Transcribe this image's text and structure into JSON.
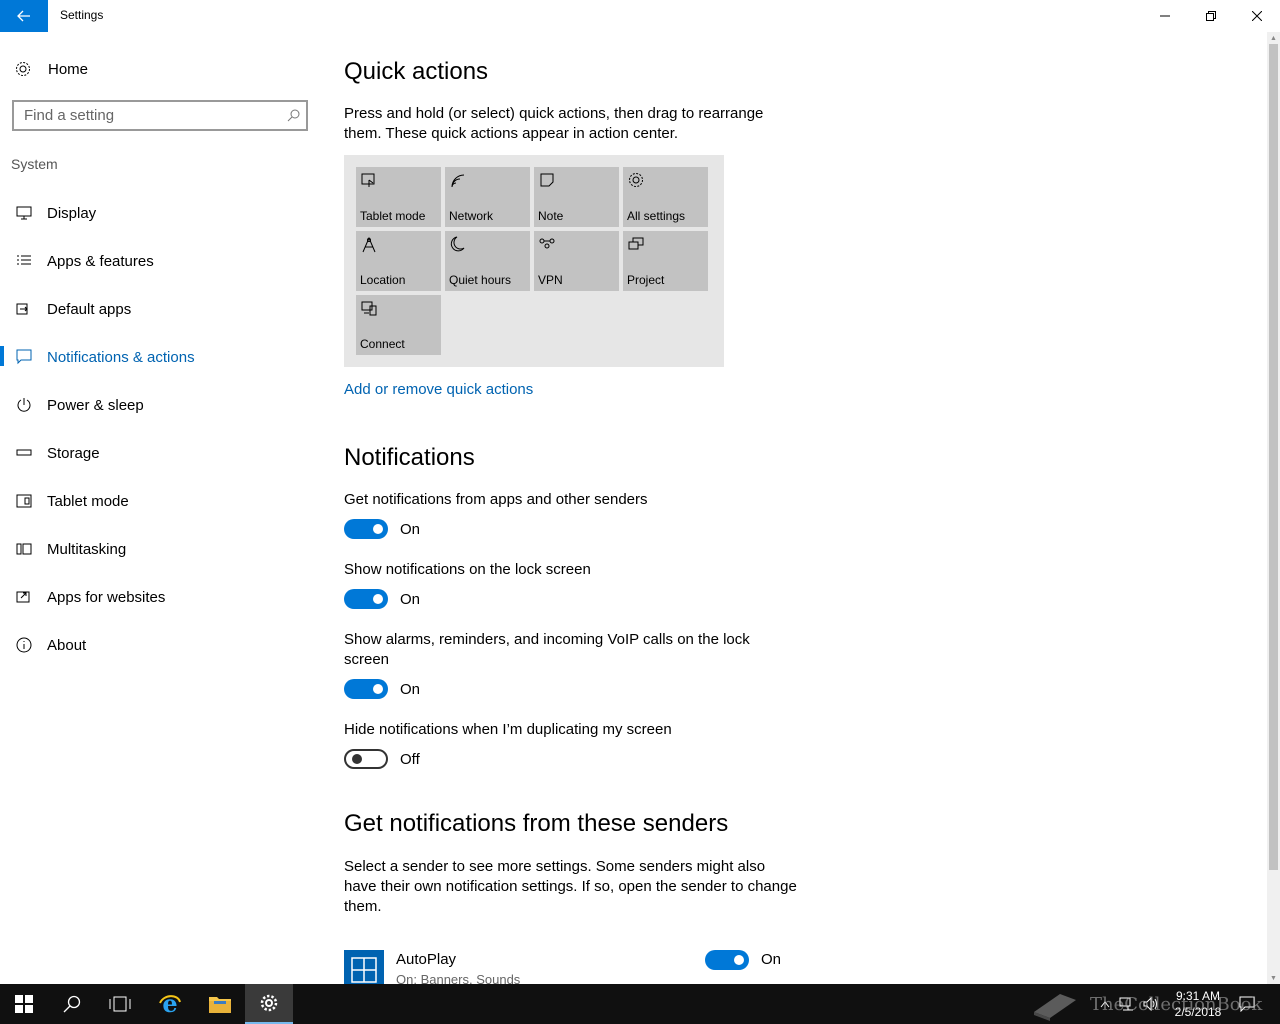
{
  "window": {
    "title": "Settings"
  },
  "sidebar": {
    "home_label": "Home",
    "search_placeholder": "Find a setting",
    "section": "System",
    "items": [
      {
        "label": "Display",
        "icon": "monitor-icon"
      },
      {
        "label": "Apps & features",
        "icon": "list-icon"
      },
      {
        "label": "Default apps",
        "icon": "default-apps-icon"
      },
      {
        "label": "Notifications & actions",
        "icon": "notification-icon",
        "active": true
      },
      {
        "label": "Power & sleep",
        "icon": "power-icon"
      },
      {
        "label": "Storage",
        "icon": "storage-icon"
      },
      {
        "label": "Tablet mode",
        "icon": "tablet-icon"
      },
      {
        "label": "Multitasking",
        "icon": "multitasking-icon"
      },
      {
        "label": "Apps for websites",
        "icon": "apps-websites-icon"
      },
      {
        "label": "About",
        "icon": "info-icon"
      }
    ]
  },
  "quick_actions": {
    "title": "Quick actions",
    "description": "Press and hold (or select) quick actions, then drag to rearrange them. These quick actions appear in action center.",
    "tiles": [
      {
        "label": "Tablet mode",
        "icon": "tablet-mode-icon"
      },
      {
        "label": "Network",
        "icon": "network-icon"
      },
      {
        "label": "Note",
        "icon": "note-icon"
      },
      {
        "label": "All settings",
        "icon": "gear-icon"
      },
      {
        "label": "Location",
        "icon": "location-icon"
      },
      {
        "label": "Quiet hours",
        "icon": "moon-icon"
      },
      {
        "label": "VPN",
        "icon": "vpn-icon"
      },
      {
        "label": "Project",
        "icon": "project-icon"
      },
      {
        "label": "Connect",
        "icon": "connect-icon"
      }
    ],
    "add_remove_link": "Add or remove quick actions"
  },
  "notifications": {
    "title": "Notifications",
    "options": [
      {
        "label": "Get notifications from apps and other senders",
        "state": "On"
      },
      {
        "label": "Show notifications on the lock screen",
        "state": "On"
      },
      {
        "label": "Show alarms, reminders, and incoming VoIP calls on the lock screen",
        "state": "On"
      },
      {
        "label": "Hide notifications when I’m duplicating my screen",
        "state": "Off"
      }
    ]
  },
  "senders": {
    "title": "Get notifications from these senders",
    "description": "Select a sender to see more settings. Some senders might also have their own notification settings. If so, open the sender to change them.",
    "items": [
      {
        "name": "AutoPlay",
        "sub": "On: Banners, Sounds",
        "state": "On"
      }
    ]
  },
  "taskbar": {
    "time": "9:31 AM",
    "date": "2/5/2018",
    "watermark": "TheCollectionBook"
  },
  "colors": {
    "accent": "#0078d7",
    "link": "#0063b1",
    "tile": "#c2c2c2",
    "tile_area": "#e6e6e6"
  }
}
